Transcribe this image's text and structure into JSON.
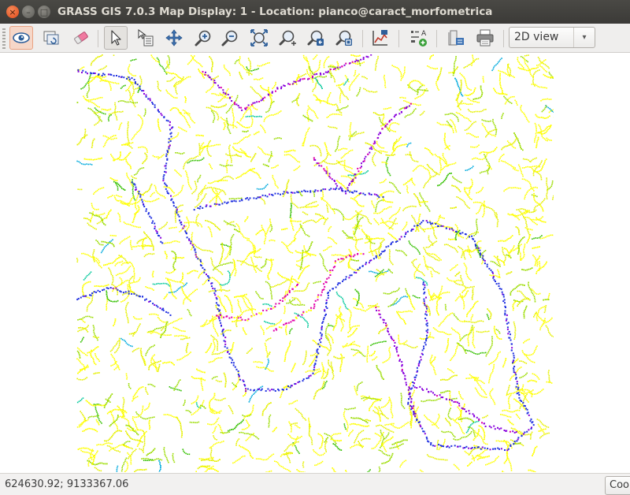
{
  "window": {
    "title": "GRASS GIS 7.0.3 Map Display: 1  - Location: pianco@caract_morfometrica",
    "close_glyph": "×",
    "minimize_glyph": "–",
    "maximize_glyph": "□"
  },
  "toolbar": {
    "tools": [
      {
        "name": "display-map-icon",
        "active": true
      },
      {
        "name": "render-map-icon"
      },
      {
        "name": "erase-display-icon"
      },
      {
        "name": "pointer-icon",
        "pressed": true
      },
      {
        "name": "query-raster-vector-icon"
      },
      {
        "name": "pan-icon"
      },
      {
        "name": "zoom-in-icon"
      },
      {
        "name": "zoom-out-icon"
      },
      {
        "name": "zoom-extent-icon"
      },
      {
        "name": "zoom-options-icon"
      },
      {
        "name": "zoom-back-icon"
      },
      {
        "name": "zoom-region-icon"
      },
      {
        "name": "analyze-map-icon"
      },
      {
        "name": "overlay-icon"
      },
      {
        "name": "save-file-icon"
      },
      {
        "name": "print-icon"
      }
    ],
    "view_mode": {
      "selected": "2D view",
      "arrow_glyph": "▾"
    }
  },
  "map": {
    "colors": [
      "#ffff00",
      "#e6f000",
      "#9bdc00",
      "#34c000",
      "#00c89a",
      "#00aadd",
      "#2030e0",
      "#8800dd",
      "#e000aa"
    ]
  },
  "status": {
    "coordinates": "624630.92; 9133367.06",
    "mode_combo": "Coordinates"
  }
}
